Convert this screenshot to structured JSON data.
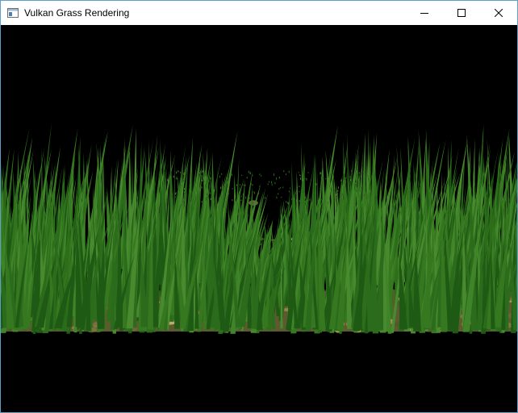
{
  "window": {
    "title": "Vulkan Grass Rendering",
    "controls": {
      "minimize_icon": "minimize-icon",
      "maximize_icon": "maximize-icon",
      "close_icon": "close-icon"
    }
  },
  "scene": {
    "background_color": "#000000",
    "grass_colors": [
      "#1f5a14",
      "#2a6b1c",
      "#35781f",
      "#3f8428",
      "#2e6e1b",
      "#4a8a2e"
    ],
    "ground_colors": [
      "#6b6a3a",
      "#8a7f45",
      "#a09050",
      "#4f5a2a",
      "#c4b070"
    ]
  }
}
